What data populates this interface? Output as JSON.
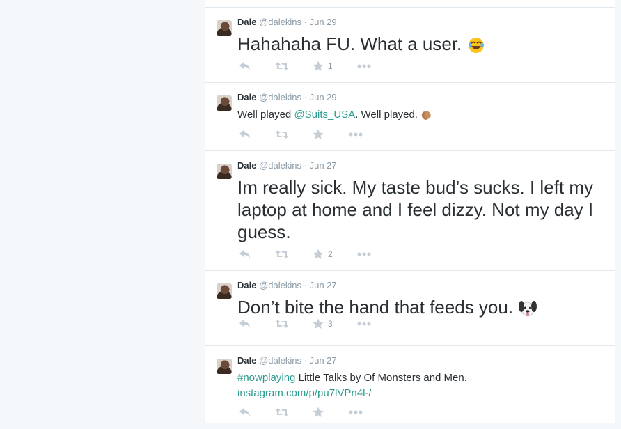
{
  "tweets": [
    {
      "name": "Dale",
      "handle": "@dalekins",
      "sep": "·",
      "date": "Jun 29",
      "text_parts": [
        "Hahahaha FU. What a user."
      ],
      "emoji": "laughing-tears-emoji",
      "favorites": "1"
    },
    {
      "name": "Dale",
      "handle": "@dalekins",
      "sep": "·",
      "date": "Jun 29",
      "text_before": "Well played ",
      "mention": "@Suits_USA",
      "text_after": ". Well played.",
      "emoji": "clapping-hands-emoji",
      "favorites": ""
    },
    {
      "name": "Dale",
      "handle": "@dalekins",
      "sep": "·",
      "date": "Jun 27",
      "text": "Im really sick. My taste bud’s sucks. I left my laptop at home and I feel dizzy. Not my day I guess.",
      "favorites": "2"
    },
    {
      "name": "Dale",
      "handle": "@dalekins",
      "sep": "·",
      "date": "Jun 27",
      "text": "Don’t bite the hand that feeds you.",
      "emoji": "dog-face-emoji",
      "favorites": "3"
    },
    {
      "name": "Dale",
      "handle": "@dalekins",
      "sep": "·",
      "date": "Jun 27",
      "hashtag": "#nowplaying",
      "text_after": " Little Talks by Of Monsters and Men.",
      "url": "instagram.com/p/pu7lVPn4l-/",
      "favorites": ""
    }
  ],
  "colors": {
    "link": "#2b9b8e",
    "icon": "#c5ced6",
    "text": "#292f33",
    "meta": "#8899a6",
    "border": "#e1e8ed",
    "page_bg": "#f5f8fa"
  }
}
